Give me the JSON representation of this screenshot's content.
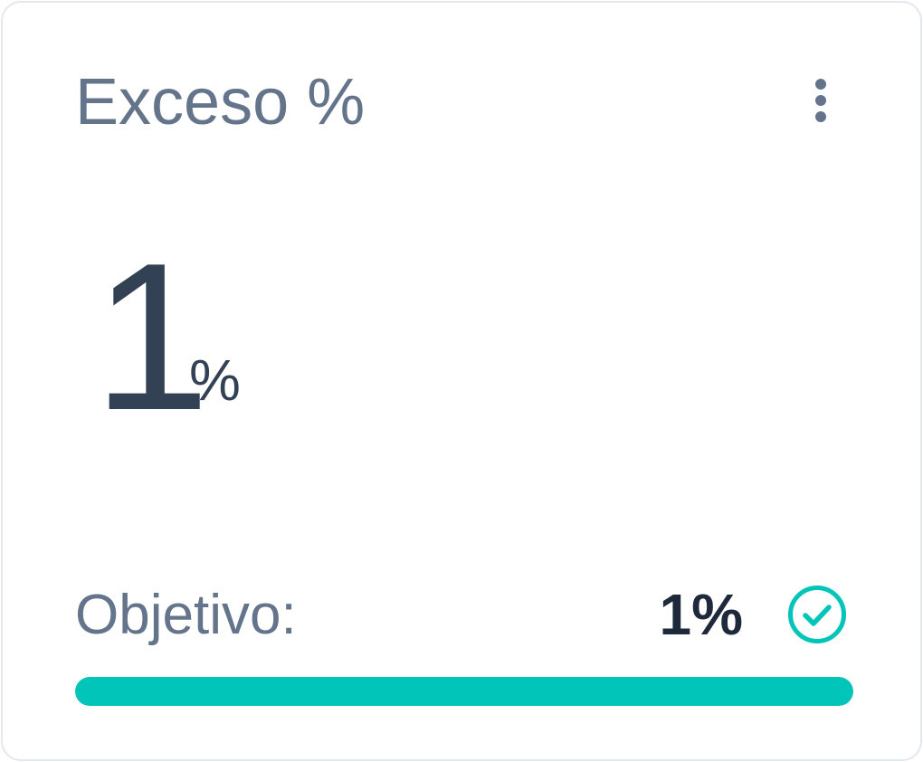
{
  "card": {
    "title": "Exceso %",
    "menu_icon": "more-vertical-icon"
  },
  "metric": {
    "value": "1",
    "unit": "%"
  },
  "goal": {
    "label": "Objetivo:",
    "value": "1%",
    "status_icon": "check-circle-icon",
    "status_color": "#00c5b8"
  },
  "progress": {
    "fraction": 1.0,
    "fill_color": "#00c5b8"
  }
}
